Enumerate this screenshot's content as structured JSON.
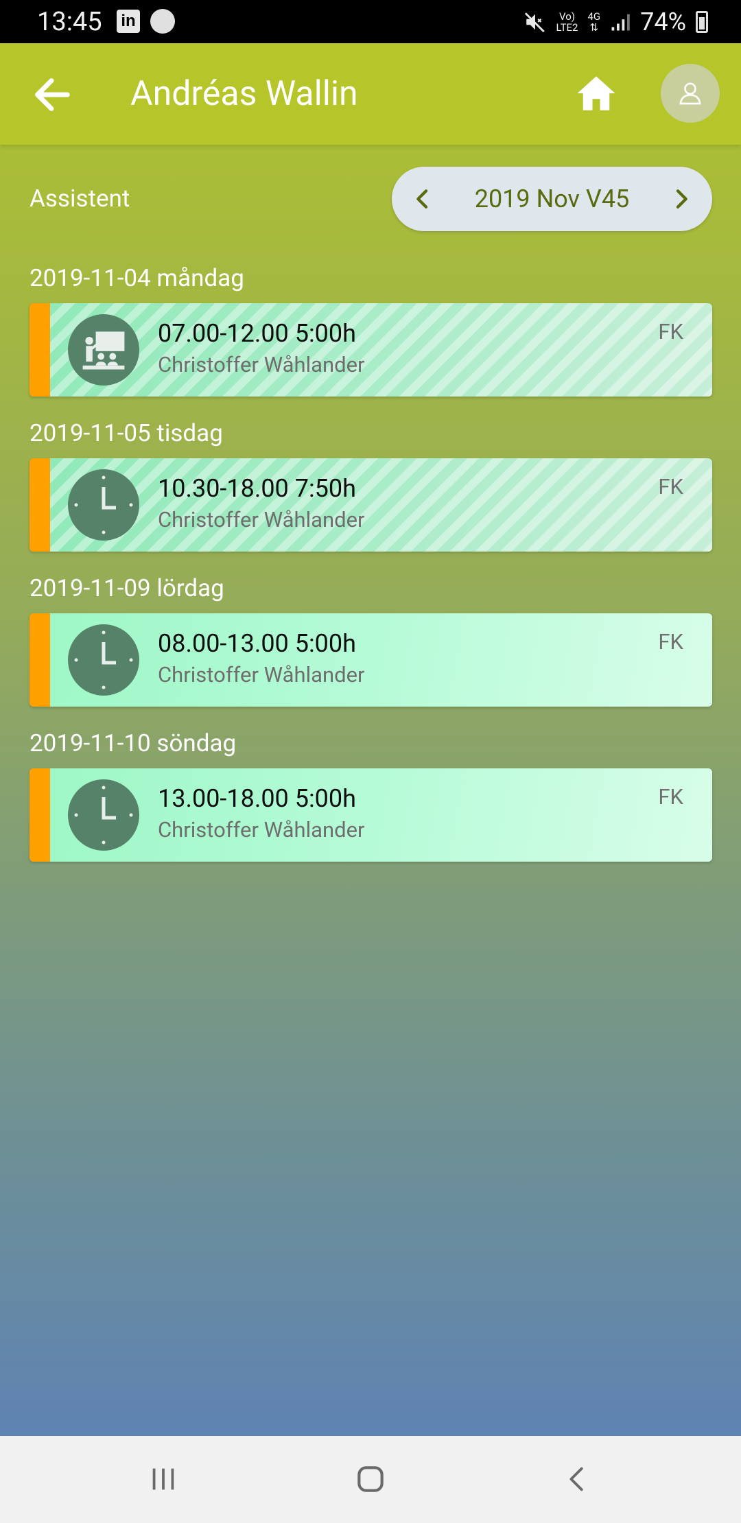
{
  "status_bar": {
    "time": "13:45",
    "linkedin_icon_text": "in",
    "network_top": "Vo)",
    "network_bottom": "LTE2",
    "network_type": "4G",
    "battery_text": "74%"
  },
  "header": {
    "title": "Andréas Wallin"
  },
  "subheader": {
    "role_label": "Assistent",
    "week_label": "2019 Nov V45"
  },
  "days": [
    {
      "date_label": "2019-11-04 måndag",
      "shift": {
        "time": "07.00-12.00 5:00h",
        "person": "Christoffer Wåhlander",
        "code": "FK",
        "icon": "presentation-icon",
        "striped": true
      }
    },
    {
      "date_label": "2019-11-05 tisdag",
      "shift": {
        "time": "10.30-18.00 7:50h",
        "person": "Christoffer Wåhlander",
        "code": "FK",
        "icon": "clock-icon",
        "striped": true
      }
    },
    {
      "date_label": "2019-11-09 lördag",
      "shift": {
        "time": "08.00-13.00 5:00h",
        "person": "Christoffer Wåhlander",
        "code": "FK",
        "icon": "clock-icon",
        "striped": false
      }
    },
    {
      "date_label": "2019-11-10 söndag",
      "shift": {
        "time": "13.00-18.00 5:00h",
        "person": "Christoffer Wåhlander",
        "code": "FK",
        "icon": "clock-icon",
        "striped": false
      }
    }
  ],
  "colors": {
    "app_bar": "#b5c52a",
    "accent_bar": "#ff9f00",
    "icon_circle": "#56826a",
    "week_text": "#5a6a0e"
  },
  "navigation_bar": {
    "buttons": [
      "recent-apps-icon",
      "home-circle-icon",
      "back-chevron-icon"
    ]
  }
}
